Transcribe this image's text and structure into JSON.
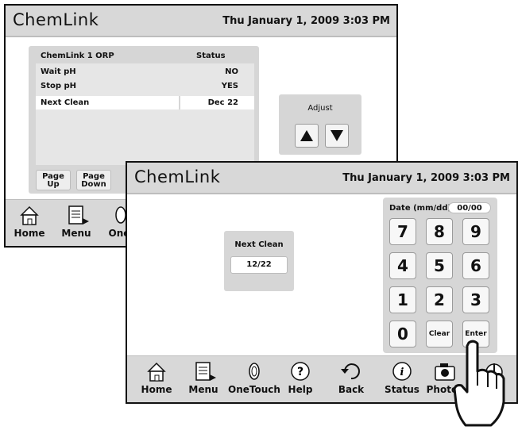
{
  "back_screen": {
    "app_title": "ChemLink",
    "datetime": "Thu January 1, 2009  3:03 PM",
    "table": {
      "headers": [
        "ChemLink 1 ORP",
        "Status"
      ],
      "rows": [
        {
          "label": "Wait pH",
          "value": "NO"
        },
        {
          "label": "Stop pH",
          "value": "YES"
        },
        {
          "label": "Next Clean",
          "value": "Dec 22"
        }
      ]
    },
    "page_up_label": "Page Up",
    "page_down_label": "Page Down",
    "adjust_label": "Adjust",
    "nav": [
      "Home",
      "Menu",
      "One"
    ]
  },
  "front_screen": {
    "app_title": "ChemLink",
    "datetime": "Thu January 1, 2009  3:03 PM",
    "next_clean_label": "Next Clean",
    "next_clean_value": "12/22",
    "keypad": {
      "label": "Date (mm/dd)",
      "value": "00/00",
      "keys": [
        "7",
        "8",
        "9",
        "4",
        "5",
        "6",
        "1",
        "2",
        "3",
        "0",
        "Clear",
        "Enter"
      ]
    },
    "nav": [
      "Home",
      "Menu",
      "OneTouch",
      "Help",
      "Back",
      "Status",
      "Photos"
    ]
  }
}
